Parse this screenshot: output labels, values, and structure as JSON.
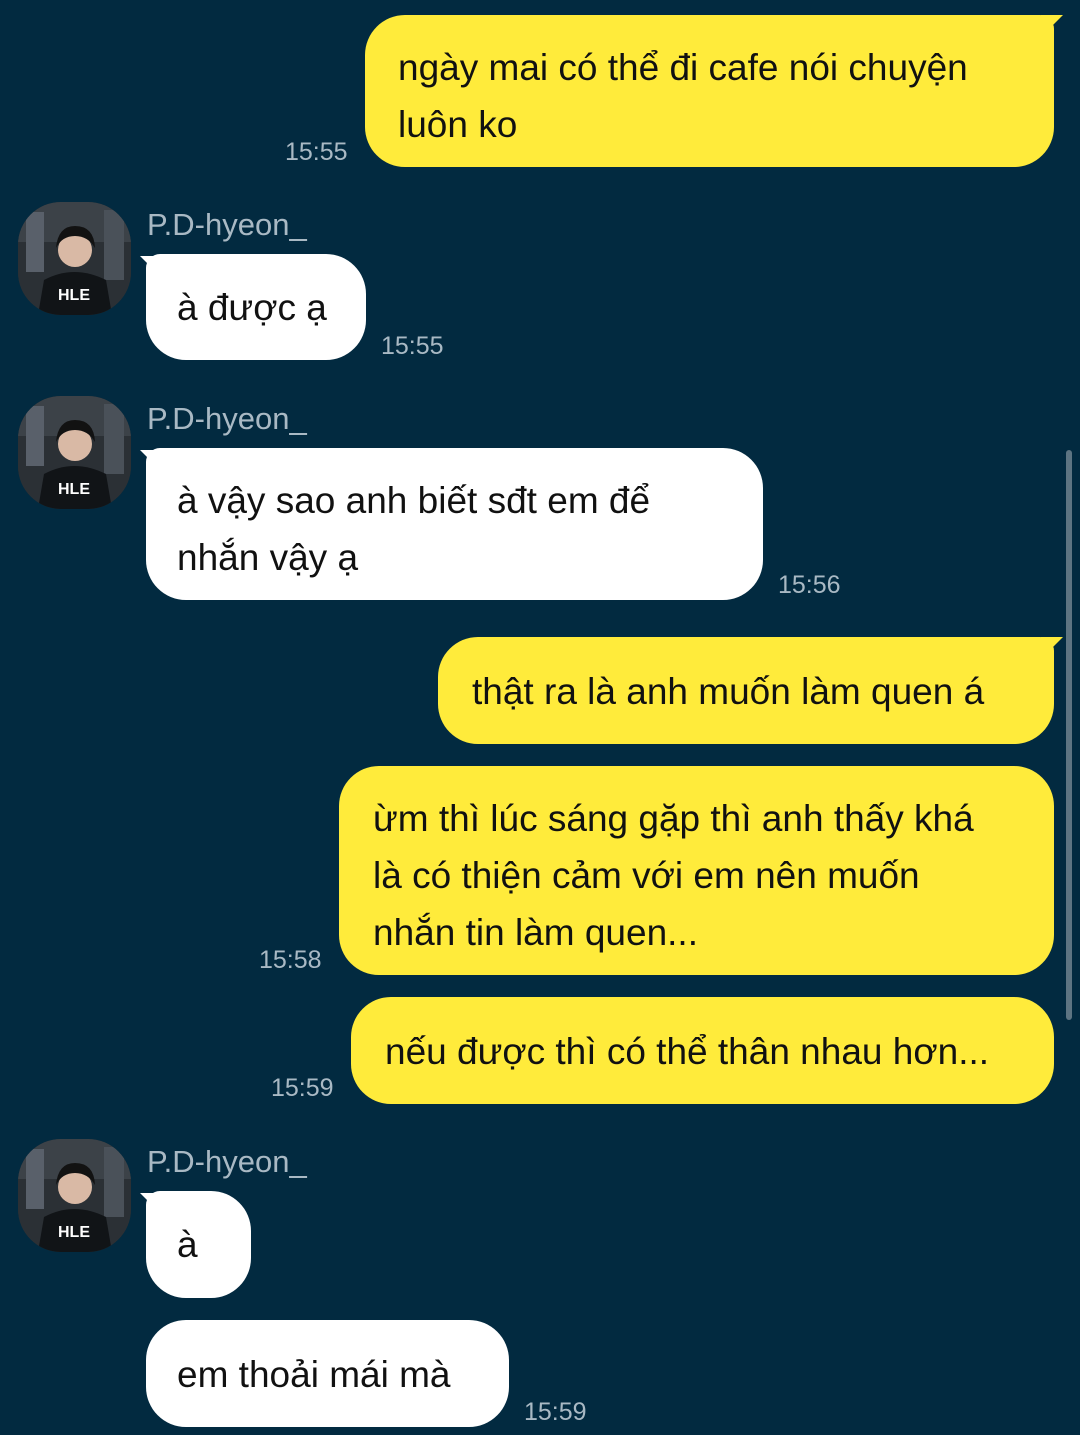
{
  "contact": {
    "name": "P.D-hyeon_",
    "avatar_text": "HLE"
  },
  "messages": [
    {
      "side": "out",
      "text_lines": [
        "ngày mai có thể đi cafe nói chuyện",
        "luôn ko"
      ],
      "time": "15:55"
    },
    {
      "side": "in",
      "sender": "P.D-hyeon_",
      "text_lines": [
        "à được ạ"
      ],
      "time": "15:55"
    },
    {
      "side": "in",
      "sender": "P.D-hyeon_",
      "text_lines": [
        "à vậy sao anh biết sđt em để",
        "nhắn vậy ạ"
      ],
      "time": "15:56"
    },
    {
      "side": "out",
      "text_lines": [
        "thật ra là anh muốn làm quen á"
      ]
    },
    {
      "side": "out",
      "text_lines": [
        "ừm thì lúc sáng gặp thì anh thấy khá",
        "là có thiện cảm với em nên muốn",
        "nhắn tin làm quen..."
      ],
      "time": "15:58"
    },
    {
      "side": "out",
      "text_lines": [
        "nếu được thì có thể thân nhau hơn..."
      ],
      "time": "15:59"
    },
    {
      "side": "in",
      "sender": "P.D-hyeon_",
      "text_lines": [
        "à"
      ]
    },
    {
      "side": "in",
      "text_lines": [
        "em thoải mái mà"
      ],
      "time": "15:59"
    }
  ],
  "colors": {
    "background": "#022a40",
    "outgoing_bubble": "#ffeb3b",
    "incoming_bubble": "#ffffff",
    "meta_text": "#a9b9c4"
  }
}
